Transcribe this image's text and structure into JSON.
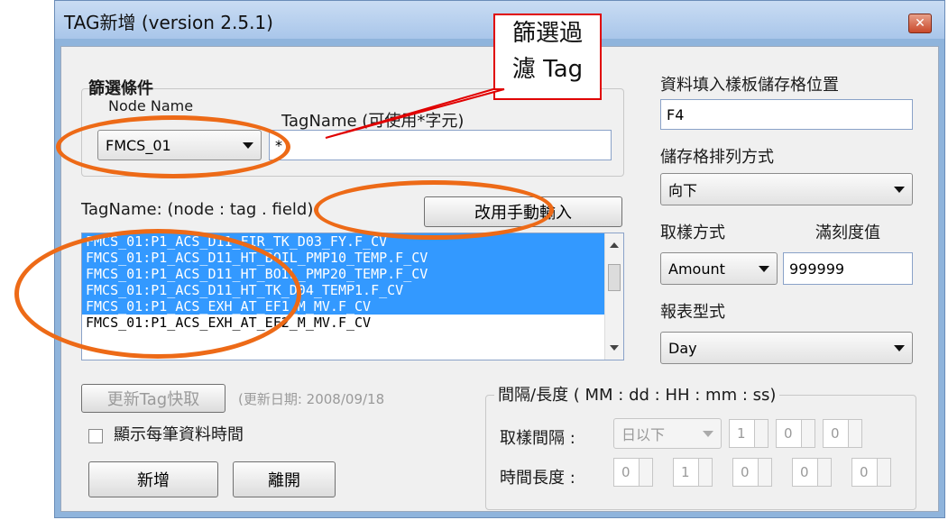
{
  "window": {
    "title": "TAG新增 (version 2.5.1)",
    "close_icon": "close-icon"
  },
  "filter": {
    "group_label": "篩選條件",
    "node_label": "Node Name",
    "node_value": "FMCS_01",
    "tagname_label": "TagName (可使用*字元)",
    "tagname_value": "*"
  },
  "taglist": {
    "header": "TagName: (node : tag . field)",
    "manual_button": "改用手動輸入",
    "items": [
      "FMCS_01:P1_ACS_D11_FIR_TK_D03_FY.F_CV",
      "FMCS_01:P1_ACS_D11_HT_BOIL_PMP10_TEMP.F_CV",
      "FMCS_01:P1_ACS_D11_HT_BOIL_PMP20_TEMP.F_CV",
      "FMCS_01:P1_ACS_D11_HT_TK_D04_TEMP1.F_CV",
      "FMCS_01:P1_ACS_EXH_AT_EF1_M_MV.F_CV",
      "FMCS_01:P1_ACS_EXH_AT_EF2_M_MV.F_CV"
    ],
    "selected_count": 5
  },
  "update": {
    "button": "更新Tag快取",
    "date_text": "(更新日期: 2008/09/18"
  },
  "show_time_checkbox": {
    "label": "顯示每筆資料時間",
    "checked": false
  },
  "actions": {
    "add": "新增",
    "leave": "離開"
  },
  "right_panel": {
    "cell_label": "資料填入樣板儲存格位置",
    "cell_value": "F4",
    "order_label": "儲存格排列方式",
    "order_value": "向下",
    "sample_label": "取樣方式",
    "fullscale_label": "滿刻度值",
    "sample_value": "Amount",
    "fullscale_value": "999999",
    "report_label": "報表型式",
    "report_value": "Day"
  },
  "interval": {
    "group_label": "間隔/長度 ( MM : dd : HH : mm : ss)",
    "sample_interval_label": "取樣間隔 :",
    "sample_interval_unit": "日以下",
    "sample_interval_values": [
      "1",
      "0",
      "0"
    ],
    "duration_label": "時間長度 :",
    "duration_values": [
      "0",
      "1",
      "0",
      "0",
      "0"
    ]
  },
  "annotation": {
    "callout_text_1": "篩選過",
    "callout_text_2": "濾 Tag"
  },
  "colors": {
    "selection": "#3399ff",
    "highlight_ellipse": "#ed6a17",
    "callout_border": "#e00000"
  }
}
